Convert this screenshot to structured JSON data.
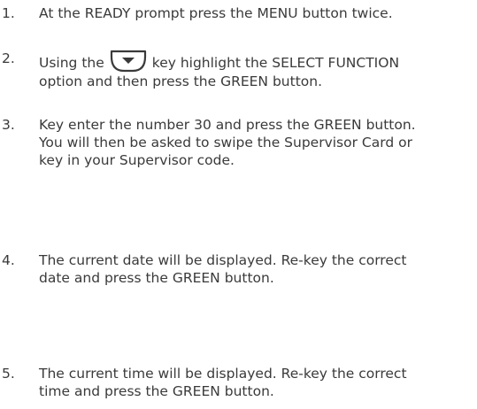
{
  "steps": [
    {
      "number": "1.",
      "lines": [
        "At the READY prompt press the MENU button twice."
      ]
    },
    {
      "number": "2.",
      "lines": [
        {
          "before": "Using the",
          "icon": "down-arrow-key-icon",
          "after": "key highlight the SELECT FUNCTION"
        },
        "option and then press the GREEN button."
      ]
    },
    {
      "number": "3.",
      "lines": [
        "Key enter the number 30 and press the GREEN button.",
        "You will then be asked to swipe the Supervisor Card or",
        "key in your Supervisor code."
      ]
    },
    {
      "number": "4.",
      "lines": [
        "The current date will be displayed. Re-key the correct",
        "date and press the GREEN button."
      ]
    },
    {
      "number": "5.",
      "lines": [
        "The current time will be displayed. Re-key the correct",
        "time and press the GREEN button."
      ]
    }
  ]
}
